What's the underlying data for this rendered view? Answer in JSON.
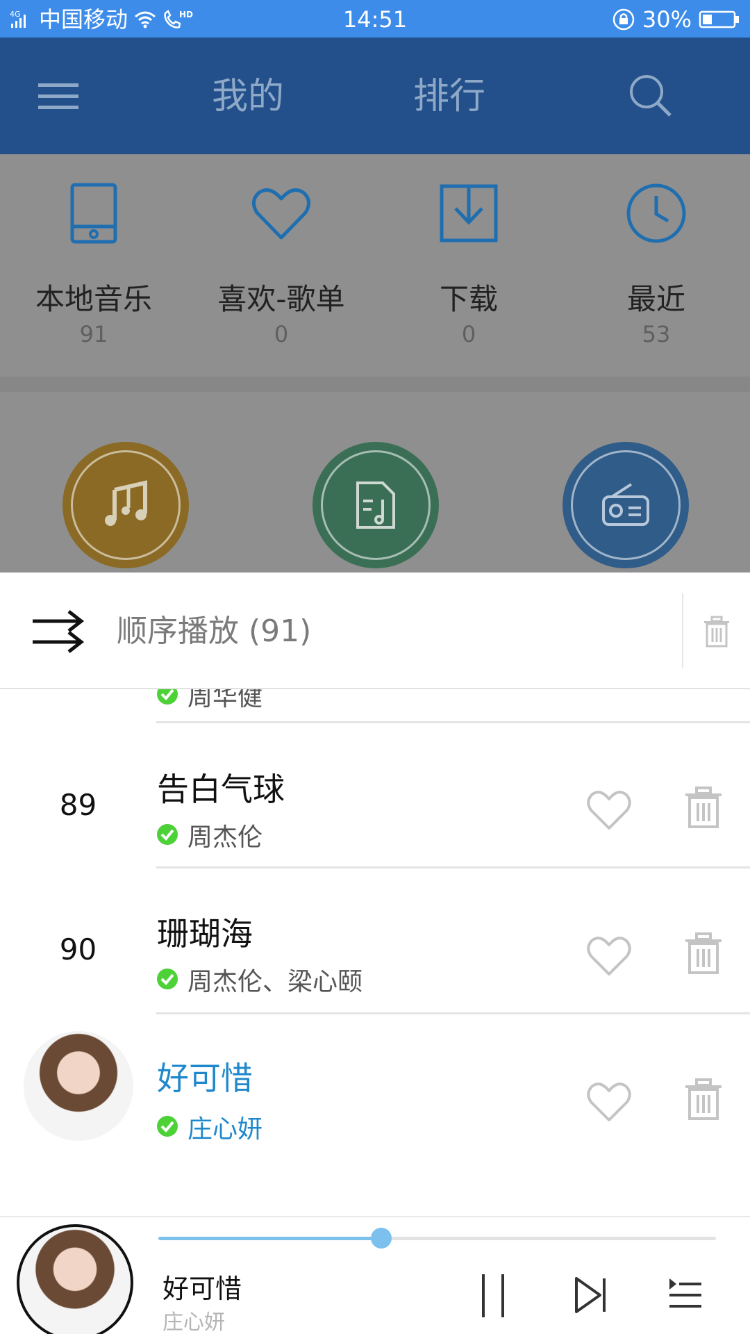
{
  "status_bar": {
    "network": "4G",
    "carrier": "中国移动",
    "hd": "HD",
    "time": "14:51",
    "battery": "30%",
    "battery_level": 0.3
  },
  "header": {
    "tabs": [
      "我的",
      "排行"
    ],
    "menu_icon": "hamburger-icon",
    "search_icon": "search-icon"
  },
  "shortcuts": [
    {
      "label": "本地音乐",
      "count": "91",
      "icon": "tablet-icon"
    },
    {
      "label": "喜欢-歌单",
      "count": "0",
      "icon": "heart-icon"
    },
    {
      "label": "下载",
      "count": "0",
      "icon": "download-icon"
    },
    {
      "label": "最近",
      "count": "53",
      "icon": "clock-icon"
    }
  ],
  "feature_circles": [
    {
      "icon": "music-notes-icon",
      "color": "#8a6a24"
    },
    {
      "icon": "music-file-icon",
      "color": "#3b6f55"
    },
    {
      "icon": "radio-icon",
      "color": "#2f5c88"
    }
  ],
  "playlist_sheet": {
    "mode_label": "顺序播放 (91)",
    "rows": [
      {
        "number": "",
        "title": "",
        "artist": "周华健",
        "active": false
      },
      {
        "number": "89",
        "title": "告白气球",
        "artist": "周杰伦",
        "active": false
      },
      {
        "number": "90",
        "title": "珊瑚海",
        "artist": "周杰伦、梁心颐",
        "active": false
      },
      {
        "number": "",
        "title": "好可惜",
        "artist": "庄心妍",
        "active": true
      }
    ]
  },
  "player": {
    "title": "好可惜",
    "artist": "庄心妍",
    "progress": 0.4
  },
  "colors": {
    "status_bar": "#3d8ce9",
    "app_bar": "#23508a",
    "accent": "#1f88cc",
    "check": "#4cd137"
  }
}
